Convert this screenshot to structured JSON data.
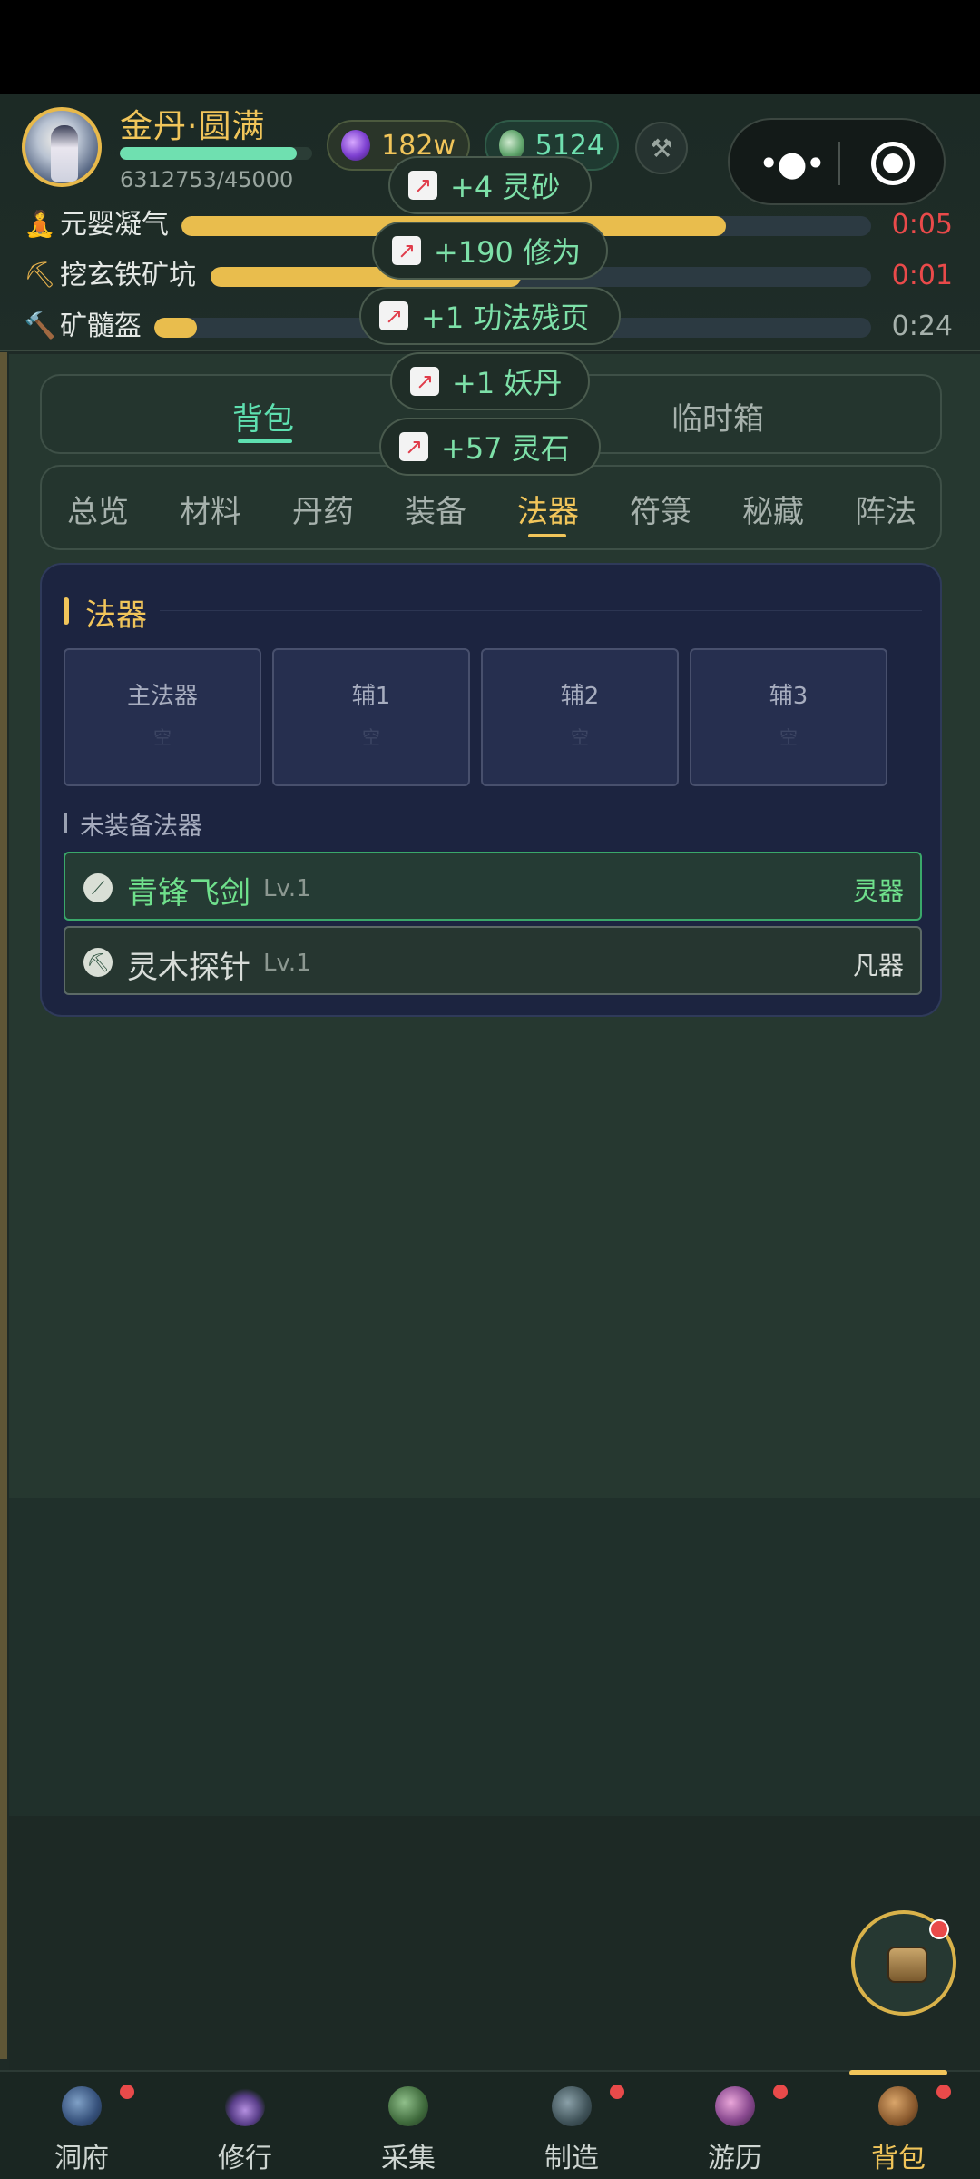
{
  "header": {
    "player_name": "金丹·圆满",
    "exp_text": "6312753/45000",
    "exp_fraction": 0.92,
    "spirit_amount": "182w",
    "jade_amount": "5124"
  },
  "tasks": [
    {
      "name": "元婴凝气",
      "time": "0:05",
      "progress": 0.79,
      "icon": "meditation-icon"
    },
    {
      "name": "挖玄铁矿坑",
      "time": "0:01",
      "progress": 0.47,
      "icon": "pickaxe-icon"
    },
    {
      "name": "矿髓盔",
      "time": "0:24",
      "progress": 0.06,
      "icon": "hammer-icon"
    }
  ],
  "toasts": [
    "+4 灵砂",
    "+190 修为",
    "+1 功法残页",
    "+1 妖丹",
    "+57 灵石"
  ],
  "segment_tabs": [
    "背包",
    "临时箱"
  ],
  "categories": [
    "总览",
    "材料",
    "丹药",
    "装备",
    "法器",
    "符箓",
    "秘藏",
    "阵法"
  ],
  "active_category": "法器",
  "panel": {
    "title": "法器",
    "slots": [
      "主法器",
      "辅1",
      "辅2",
      "辅3"
    ],
    "slot_placeholder": "空",
    "unequipped_title": "未装备法器",
    "items": [
      {
        "name": "青锋飞剑",
        "level": "Lv.1",
        "grade": "灵器"
      },
      {
        "name": "灵木探针",
        "level": "Lv.1",
        "grade": "凡器"
      }
    ]
  },
  "nav": [
    {
      "label": "洞府",
      "badge": true
    },
    {
      "label": "修行",
      "badge": false
    },
    {
      "label": "采集",
      "badge": false
    },
    {
      "label": "制造",
      "badge": true
    },
    {
      "label": "游历",
      "badge": true
    },
    {
      "label": "背包",
      "badge": true,
      "active": true
    }
  ],
  "colors": {
    "gold": "#f1c55a",
    "jade": "#6fe0b0",
    "alert_red": "#e94a4a",
    "spirit_grade": "#6fe08c"
  }
}
